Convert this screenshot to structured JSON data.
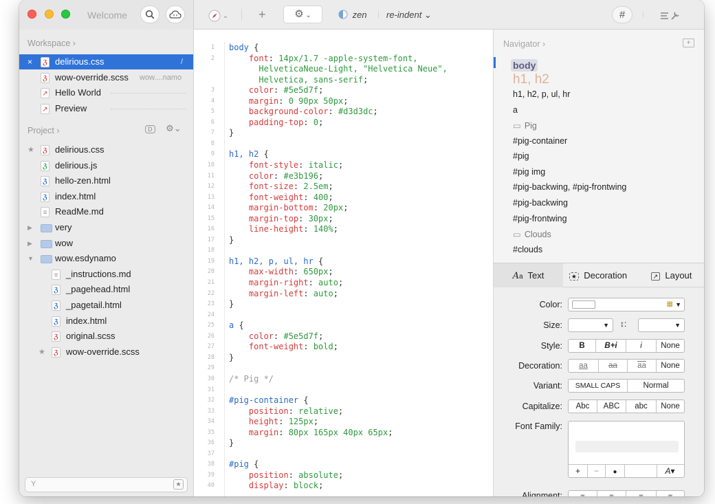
{
  "toolbar": {
    "welcome": "Welcome",
    "plus": "+",
    "zen": "zen",
    "reindent": "re-indent ⌄",
    "hash": "#"
  },
  "sidebar": {
    "workspace_label": "Workspace ›",
    "workspace": [
      {
        "label": "delirious.css",
        "type": "css",
        "selected": true
      },
      {
        "label": "wow-override.scss",
        "type": "css",
        "sub": "wow....namo"
      },
      {
        "label": "Hello World",
        "type": "compass"
      },
      {
        "label": "Preview",
        "type": "compass"
      }
    ],
    "project_label": "Project ›",
    "project": [
      {
        "label": "delirious.css",
        "type": "css",
        "mark": "★",
        "indent": 0
      },
      {
        "label": "delirious.js",
        "type": "js",
        "indent": 0
      },
      {
        "label": "hello-zen.html",
        "type": "html",
        "indent": 0
      },
      {
        "label": "index.html",
        "type": "html",
        "indent": 0
      },
      {
        "label": "ReadMe.md",
        "type": "md",
        "indent": 0
      },
      {
        "label": "very",
        "type": "folder",
        "mark": "▶",
        "indent": 0
      },
      {
        "label": "wow",
        "type": "folder",
        "mark": "▶",
        "indent": 0
      },
      {
        "label": "wow.esdynamo",
        "type": "folder",
        "mark": "▼",
        "indent": 0
      },
      {
        "label": "_instructions.md",
        "type": "md",
        "indent": 1
      },
      {
        "label": "_pagehead.html",
        "type": "html",
        "indent": 1
      },
      {
        "label": "_pagetail.html",
        "type": "html",
        "indent": 1
      },
      {
        "label": "index.html",
        "type": "html",
        "indent": 1
      },
      {
        "label": "original.scss",
        "type": "css",
        "indent": 1
      },
      {
        "label": "wow-override.scss",
        "type": "css",
        "mark": "★",
        "indent": 1
      }
    ]
  },
  "editor": {
    "lines": [
      {
        "n": "1",
        "t": [
          [
            "sl",
            "body"
          ],
          [
            "pn",
            " {"
          ]
        ]
      },
      {
        "n": "2",
        "t": [
          [
            "pr",
            "    font"
          ],
          [
            "pn",
            ": "
          ],
          [
            "vl",
            "14px/1.7 -apple-system-font,"
          ]
        ]
      },
      {
        "n": "",
        "t": [
          [
            "vl",
            "      HelveticaNeue-Light, \"Helvetica Neue\","
          ]
        ]
      },
      {
        "n": "",
        "t": [
          [
            "vl",
            "      Helvetica, sans-serif"
          ],
          [
            "pn",
            ";"
          ]
        ]
      },
      {
        "n": "3",
        "t": [
          [
            "pr",
            "    color"
          ],
          [
            "pn",
            ": "
          ],
          [
            "vl",
            "#5e5d7f"
          ],
          [
            "pn",
            ";"
          ]
        ]
      },
      {
        "n": "4",
        "t": [
          [
            "pr",
            "    margin"
          ],
          [
            "pn",
            ": "
          ],
          [
            "vl",
            "0 90px 50px"
          ],
          [
            "pn",
            ";"
          ]
        ]
      },
      {
        "n": "5",
        "t": [
          [
            "pr",
            "    background-color"
          ],
          [
            "pn",
            ": "
          ],
          [
            "vl",
            "#d3d3dc"
          ],
          [
            "pn",
            ";"
          ]
        ]
      },
      {
        "n": "6",
        "t": [
          [
            "pr",
            "    padding-top"
          ],
          [
            "pn",
            ": "
          ],
          [
            "vl",
            "0"
          ],
          [
            "pn",
            ";"
          ]
        ]
      },
      {
        "n": "7",
        "t": [
          [
            "pn",
            "}"
          ]
        ]
      },
      {
        "n": "8",
        "t": []
      },
      {
        "n": "9",
        "t": [
          [
            "sl",
            "h1, h2"
          ],
          [
            "pn",
            " {"
          ]
        ]
      },
      {
        "n": "10",
        "t": [
          [
            "pr",
            "    font-style"
          ],
          [
            "pn",
            ": "
          ],
          [
            "vl",
            "italic"
          ],
          [
            "pn",
            ";"
          ]
        ]
      },
      {
        "n": "11",
        "t": [
          [
            "pr",
            "    color"
          ],
          [
            "pn",
            ": "
          ],
          [
            "vl",
            "#e3b196"
          ],
          [
            "pn",
            ";"
          ]
        ]
      },
      {
        "n": "12",
        "t": [
          [
            "pr",
            "    font-size"
          ],
          [
            "pn",
            ": "
          ],
          [
            "vl",
            "2.5em"
          ],
          [
            "pn",
            ";"
          ]
        ]
      },
      {
        "n": "13",
        "t": [
          [
            "pr",
            "    font-weight"
          ],
          [
            "pn",
            ": "
          ],
          [
            "vl",
            "400"
          ],
          [
            "pn",
            ";"
          ]
        ]
      },
      {
        "n": "14",
        "t": [
          [
            "pr",
            "    margin-bottom"
          ],
          [
            "pn",
            ": "
          ],
          [
            "vl",
            "20px"
          ],
          [
            "pn",
            ";"
          ]
        ]
      },
      {
        "n": "15",
        "t": [
          [
            "pr",
            "    margin-top"
          ],
          [
            "pn",
            ": "
          ],
          [
            "vl",
            "30px"
          ],
          [
            "pn",
            ";"
          ]
        ]
      },
      {
        "n": "16",
        "t": [
          [
            "pr",
            "    line-height"
          ],
          [
            "pn",
            ": "
          ],
          [
            "vl",
            "140%"
          ],
          [
            "pn",
            ";"
          ]
        ]
      },
      {
        "n": "17",
        "t": [
          [
            "pn",
            "}"
          ]
        ]
      },
      {
        "n": "18",
        "t": []
      },
      {
        "n": "19",
        "t": [
          [
            "sl",
            "h1, h2, p, ul, hr"
          ],
          [
            "pn",
            " {"
          ]
        ]
      },
      {
        "n": "20",
        "t": [
          [
            "pr",
            "    max-width"
          ],
          [
            "pn",
            ": "
          ],
          [
            "vl",
            "650px"
          ],
          [
            "pn",
            ";"
          ]
        ]
      },
      {
        "n": "21",
        "t": [
          [
            "pr",
            "    margin-right"
          ],
          [
            "pn",
            ": "
          ],
          [
            "vl",
            "auto"
          ],
          [
            "pn",
            ";"
          ]
        ]
      },
      {
        "n": "22",
        "t": [
          [
            "pr",
            "    margin-left"
          ],
          [
            "pn",
            ": "
          ],
          [
            "vl",
            "auto"
          ],
          [
            "pn",
            ";"
          ]
        ]
      },
      {
        "n": "23",
        "t": [
          [
            "pn",
            "}"
          ]
        ]
      },
      {
        "n": "24",
        "t": []
      },
      {
        "n": "25",
        "t": [
          [
            "sl",
            "a"
          ],
          [
            "pn",
            " {"
          ]
        ]
      },
      {
        "n": "26",
        "t": [
          [
            "pr",
            "    color"
          ],
          [
            "pn",
            ": "
          ],
          [
            "vl",
            "#5e5d7f"
          ],
          [
            "pn",
            ";"
          ]
        ]
      },
      {
        "n": "27",
        "t": [
          [
            "pr",
            "    font-weight"
          ],
          [
            "pn",
            ": "
          ],
          [
            "vl",
            "bold"
          ],
          [
            "pn",
            ";"
          ]
        ]
      },
      {
        "n": "28",
        "t": [
          [
            "pn",
            "}"
          ]
        ]
      },
      {
        "n": "29",
        "t": []
      },
      {
        "n": "30",
        "t": [
          [
            "cm",
            "/* Pig */"
          ]
        ]
      },
      {
        "n": "31",
        "t": []
      },
      {
        "n": "32",
        "t": [
          [
            "sl",
            "#pig-container"
          ],
          [
            "pn",
            " {"
          ]
        ]
      },
      {
        "n": "33",
        "t": [
          [
            "pr",
            "    position"
          ],
          [
            "pn",
            ": "
          ],
          [
            "vl",
            "relative"
          ],
          [
            "pn",
            ";"
          ]
        ]
      },
      {
        "n": "34",
        "t": [
          [
            "pr",
            "    height"
          ],
          [
            "pn",
            ": "
          ],
          [
            "vl",
            "125px"
          ],
          [
            "pn",
            ";"
          ]
        ]
      },
      {
        "n": "35",
        "t": [
          [
            "pr",
            "    margin"
          ],
          [
            "pn",
            ": "
          ],
          [
            "vl",
            "80px 165px 40px 65px"
          ],
          [
            "pn",
            ";"
          ]
        ]
      },
      {
        "n": "36",
        "t": [
          [
            "pn",
            "}"
          ]
        ]
      },
      {
        "n": "37",
        "t": []
      },
      {
        "n": "38",
        "t": [
          [
            "sl",
            "#pig"
          ],
          [
            "pn",
            " {"
          ]
        ]
      },
      {
        "n": "39",
        "t": [
          [
            "pr",
            "    position"
          ],
          [
            "pn",
            ": "
          ],
          [
            "vl",
            "absolute"
          ],
          [
            "pn",
            ";"
          ]
        ]
      },
      {
        "n": "40",
        "t": [
          [
            "pr",
            "    display"
          ],
          [
            "pn",
            ": "
          ],
          [
            "vl",
            "block"
          ],
          [
            "pn",
            ";"
          ]
        ]
      }
    ]
  },
  "navigator": {
    "title": "Navigator ›",
    "items": [
      {
        "label": "body",
        "style": "body"
      },
      {
        "label": "h1, h2",
        "style": "h"
      },
      {
        "label": "h1, h2, p, ul, hr"
      },
      {
        "label": "a"
      },
      {
        "label": "Pig",
        "style": "comment"
      },
      {
        "label": "#pig-container"
      },
      {
        "label": "#pig"
      },
      {
        "label": "#pig img"
      },
      {
        "label": "#pig-backwing, #pig-frontwing"
      },
      {
        "label": "#pig-backwing"
      },
      {
        "label": "#pig-frontwing"
      },
      {
        "label": "Clouds",
        "style": "comment"
      },
      {
        "label": "#clouds"
      }
    ]
  },
  "inspector": {
    "tabs": [
      "Text",
      "Decoration",
      "Layout"
    ],
    "color_label": "Color:",
    "size_label": "Size:",
    "style_label": "Style:",
    "style_opts": [
      "B",
      "B+i",
      "i",
      "None"
    ],
    "decoration_label": "Decoration:",
    "decoration_opts": [
      "aa",
      "aa",
      "aa",
      "None"
    ],
    "variant_label": "Variant:",
    "variant_opts": [
      "SMALL CAPS",
      "Normal"
    ],
    "capitalize_label": "Capitalize:",
    "capitalize_opts": [
      "Abc",
      "ABC",
      "abc",
      "None"
    ],
    "font_family_label": "Font Family:",
    "ff_add": "+",
    "ff_remove": "−",
    "alignment_label": "Alignment:"
  }
}
